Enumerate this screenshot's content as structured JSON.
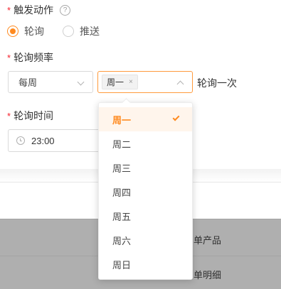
{
  "trigger": {
    "label": "触发动作",
    "required_mark": "*",
    "help_icon": "question-circle-icon",
    "help_glyph": "?",
    "options": [
      {
        "label": "轮询",
        "checked": true
      },
      {
        "label": "推送",
        "checked": false
      }
    ]
  },
  "frequency": {
    "label": "轮询频率",
    "required_mark": "*",
    "period_value": "每周",
    "day_tag": "周一",
    "tag_close": "×",
    "suffix": "轮询一次"
  },
  "poll_time": {
    "label": "轮询时间",
    "required_mark": "*",
    "value": "23:00"
  },
  "dropdown": {
    "options": [
      {
        "label": "周一",
        "selected": true
      },
      {
        "label": "周二",
        "selected": false
      },
      {
        "label": "周三",
        "selected": false
      },
      {
        "label": "周四",
        "selected": false
      },
      {
        "label": "周五",
        "selected": false
      },
      {
        "label": "周六",
        "selected": false
      },
      {
        "label": "周日",
        "selected": false
      }
    ]
  },
  "background_table": {
    "rows": [
      {
        "text": "单产品"
      },
      {
        "text": "单明细"
      }
    ]
  },
  "colors": {
    "accent": "#ff8a1f",
    "required": "#f5222d"
  }
}
